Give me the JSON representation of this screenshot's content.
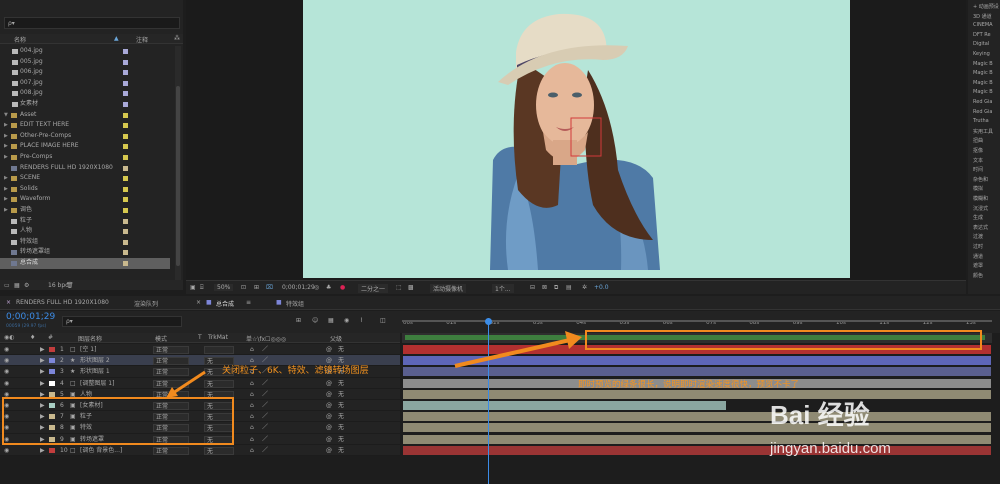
{
  "project": {
    "search_placeholder": "ρ▾",
    "col_name": "名称",
    "col_comment": "注释",
    "items": [
      {
        "name": "004.jpg",
        "kind": "file",
        "color": "#a9a9d8",
        "indent": 1
      },
      {
        "name": "005.jpg",
        "kind": "file",
        "color": "#a9a9d8",
        "indent": 1
      },
      {
        "name": "006.jpg",
        "kind": "file",
        "color": "#a9a9d8",
        "indent": 1
      },
      {
        "name": "007.jpg",
        "kind": "file",
        "color": "#a9a9d8",
        "indent": 1
      },
      {
        "name": "008.jpg",
        "kind": "file",
        "color": "#a9a9d8",
        "indent": 1
      },
      {
        "name": "女素材",
        "kind": "file",
        "color": "#a9a9d8",
        "indent": 1
      },
      {
        "name": "Asset",
        "kind": "folder-open",
        "color": "#d6c84e",
        "indent": 0
      },
      {
        "name": "EDIT TEXT HERE",
        "kind": "folder",
        "color": "#d6c84e",
        "indent": 0
      },
      {
        "name": "Other-Pre-Comps",
        "kind": "folder",
        "color": "#d6c84e",
        "indent": 0
      },
      {
        "name": "PLACE IMAGE HERE",
        "kind": "folder",
        "color": "#d6c84e",
        "indent": 0
      },
      {
        "name": "Pre-Comps",
        "kind": "folder",
        "color": "#d6c84e",
        "indent": 0
      },
      {
        "name": "RENDERS FULL HD 1920X1080",
        "kind": "comp",
        "color": "#c9b98e",
        "indent": 0
      },
      {
        "name": "SCENE",
        "kind": "folder",
        "color": "#d6c84e",
        "indent": 0
      },
      {
        "name": "Solids",
        "kind": "folder",
        "color": "#d6c84e",
        "indent": 0
      },
      {
        "name": "Waveform",
        "kind": "folder",
        "color": "#d6c84e",
        "indent": 0
      },
      {
        "name": "调色",
        "kind": "folder",
        "color": "#d6c84e",
        "indent": 0
      },
      {
        "name": "粒子",
        "kind": "file",
        "color": "#c9b98e",
        "indent": 0
      },
      {
        "name": "人物",
        "kind": "file",
        "color": "#c9b98e",
        "indent": 0
      },
      {
        "name": "特效组",
        "kind": "file",
        "color": "#c9b98e",
        "indent": 0
      },
      {
        "name": "转场遮罩组",
        "kind": "comp",
        "color": "#c9b98e",
        "indent": 0
      },
      {
        "name": "总合成",
        "kind": "comp",
        "color": "#c9b98e",
        "indent": 0,
        "selected": true
      }
    ],
    "footer": "16 bpc"
  },
  "viewer": {
    "zoom": "50%",
    "timecode": "0;00;01;29",
    "resolution": "二分之一",
    "camera": "活动摄像机",
    "views": "1个...",
    "exposure": "+0.0"
  },
  "effects_panel": {
    "items": [
      "+ 动画预设",
      "3D 通道",
      "CINEMA",
      "DFT Re",
      "Digital",
      "Keying",
      "Magic B",
      "Magic B",
      "Magic B",
      "Magic B",
      "Red Gia",
      "Red Gia",
      "Trutha",
      "实用工具",
      "扭曲",
      "抠像",
      "文本",
      "时间",
      "杂色和",
      "模拟",
      "模糊和",
      "沉浸式",
      "生成",
      "表达式",
      "过渡",
      "过时",
      "通道",
      "遮罩",
      "颜色"
    ]
  },
  "tabs": {
    "render_tab": "RENDERS FULL HD 1920X1080",
    "queue_tab": "渲染队列",
    "main_tab": "总合成",
    "fx_tab": "特效组"
  },
  "timeline": {
    "timecode": "0;00;01;29",
    "timecode_sub": "00059 (29.97 fps)",
    "search_placeholder": "ρ▾",
    "headers": {
      "name": "图层名称",
      "mode": "模式",
      "t": "T",
      "trkmat": "TrkMat",
      "switches": "单☆\\fx☐◎◎◎",
      "parent": "父级"
    },
    "ruler": [
      "00s",
      "01s",
      "02s",
      "03s",
      "04s",
      "05s",
      "06s",
      "07s",
      "08s",
      "09s",
      "10s",
      "11s",
      "12s",
      "13s"
    ],
    "layers": [
      {
        "num": "1",
        "name": "[空 1]",
        "label": "#c23d3d",
        "icon": "□",
        "mode": "正常",
        "trk": "",
        "parent": "无",
        "bar": "#b23030",
        "bar_end": 1.0
      },
      {
        "num": "2",
        "name": "形状图层 2",
        "label": "#7d86d9",
        "icon": "★",
        "mode": "正常",
        "trk": "无",
        "parent": "无",
        "bar": "#5e66b8",
        "bar_end": 1.0,
        "hl": true
      },
      {
        "num": "3",
        "name": "形状图层 1",
        "label": "#7d86d9",
        "icon": "★",
        "mode": "正常",
        "trk": "无",
        "parent": "无",
        "bar": "#5a5f8f",
        "bar_end": 1.0
      },
      {
        "num": "4",
        "name": "[调整图层 1]",
        "label": "#ffffff",
        "icon": "□",
        "mode": "正常",
        "trk": "无",
        "parent": "无",
        "bar": "#8c8c8c",
        "bar_end": 1.0
      },
      {
        "num": "5",
        "name": "人物",
        "label": "#c9b98e",
        "icon": "▣",
        "mode": "正常",
        "trk": "无",
        "parent": "无",
        "bar": "#8f8a73",
        "bar_end": 1.0
      },
      {
        "num": "6",
        "name": "[女素材]",
        "label": "#a9cfc4",
        "icon": "▣",
        "mode": "正常",
        "trk": "无",
        "parent": "无",
        "bar": "#8aa6a0",
        "bar_end": 0.55
      },
      {
        "num": "7",
        "name": "粒子",
        "label": "#c9b98e",
        "icon": "▣",
        "mode": "正常",
        "trk": "无",
        "parent": "无",
        "bar": "#8f8a73",
        "bar_end": 1.0
      },
      {
        "num": "8",
        "name": "特效",
        "label": "#c9b98e",
        "icon": "▣",
        "mode": "正常",
        "trk": "无",
        "parent": "无",
        "bar": "#8f8a73",
        "bar_end": 1.0
      },
      {
        "num": "9",
        "name": "转场遮罩",
        "label": "#c9b98e",
        "icon": "▣",
        "mode": "正常",
        "trk": "无",
        "parent": "无",
        "bar": "#8f8a73",
        "bar_end": 1.0
      },
      {
        "num": "10",
        "name": "[调色 背景色...]",
        "label": "#c23d3d",
        "icon": "□",
        "mode": "正常",
        "trk": "无",
        "parent": "无",
        "bar": "#9a3434",
        "bar_end": 1.0
      }
    ]
  },
  "annotations": {
    "left_note": "关闭粒子、6K、特效、滤镜转场图层",
    "right_note": "即时预览的绿条很长，说明即时渲染速度很快，预览不卡了",
    "accent": "#f18a1e"
  },
  "watermark": {
    "text": "jingyan.baidu.com",
    "logo": "Bai 经验"
  }
}
